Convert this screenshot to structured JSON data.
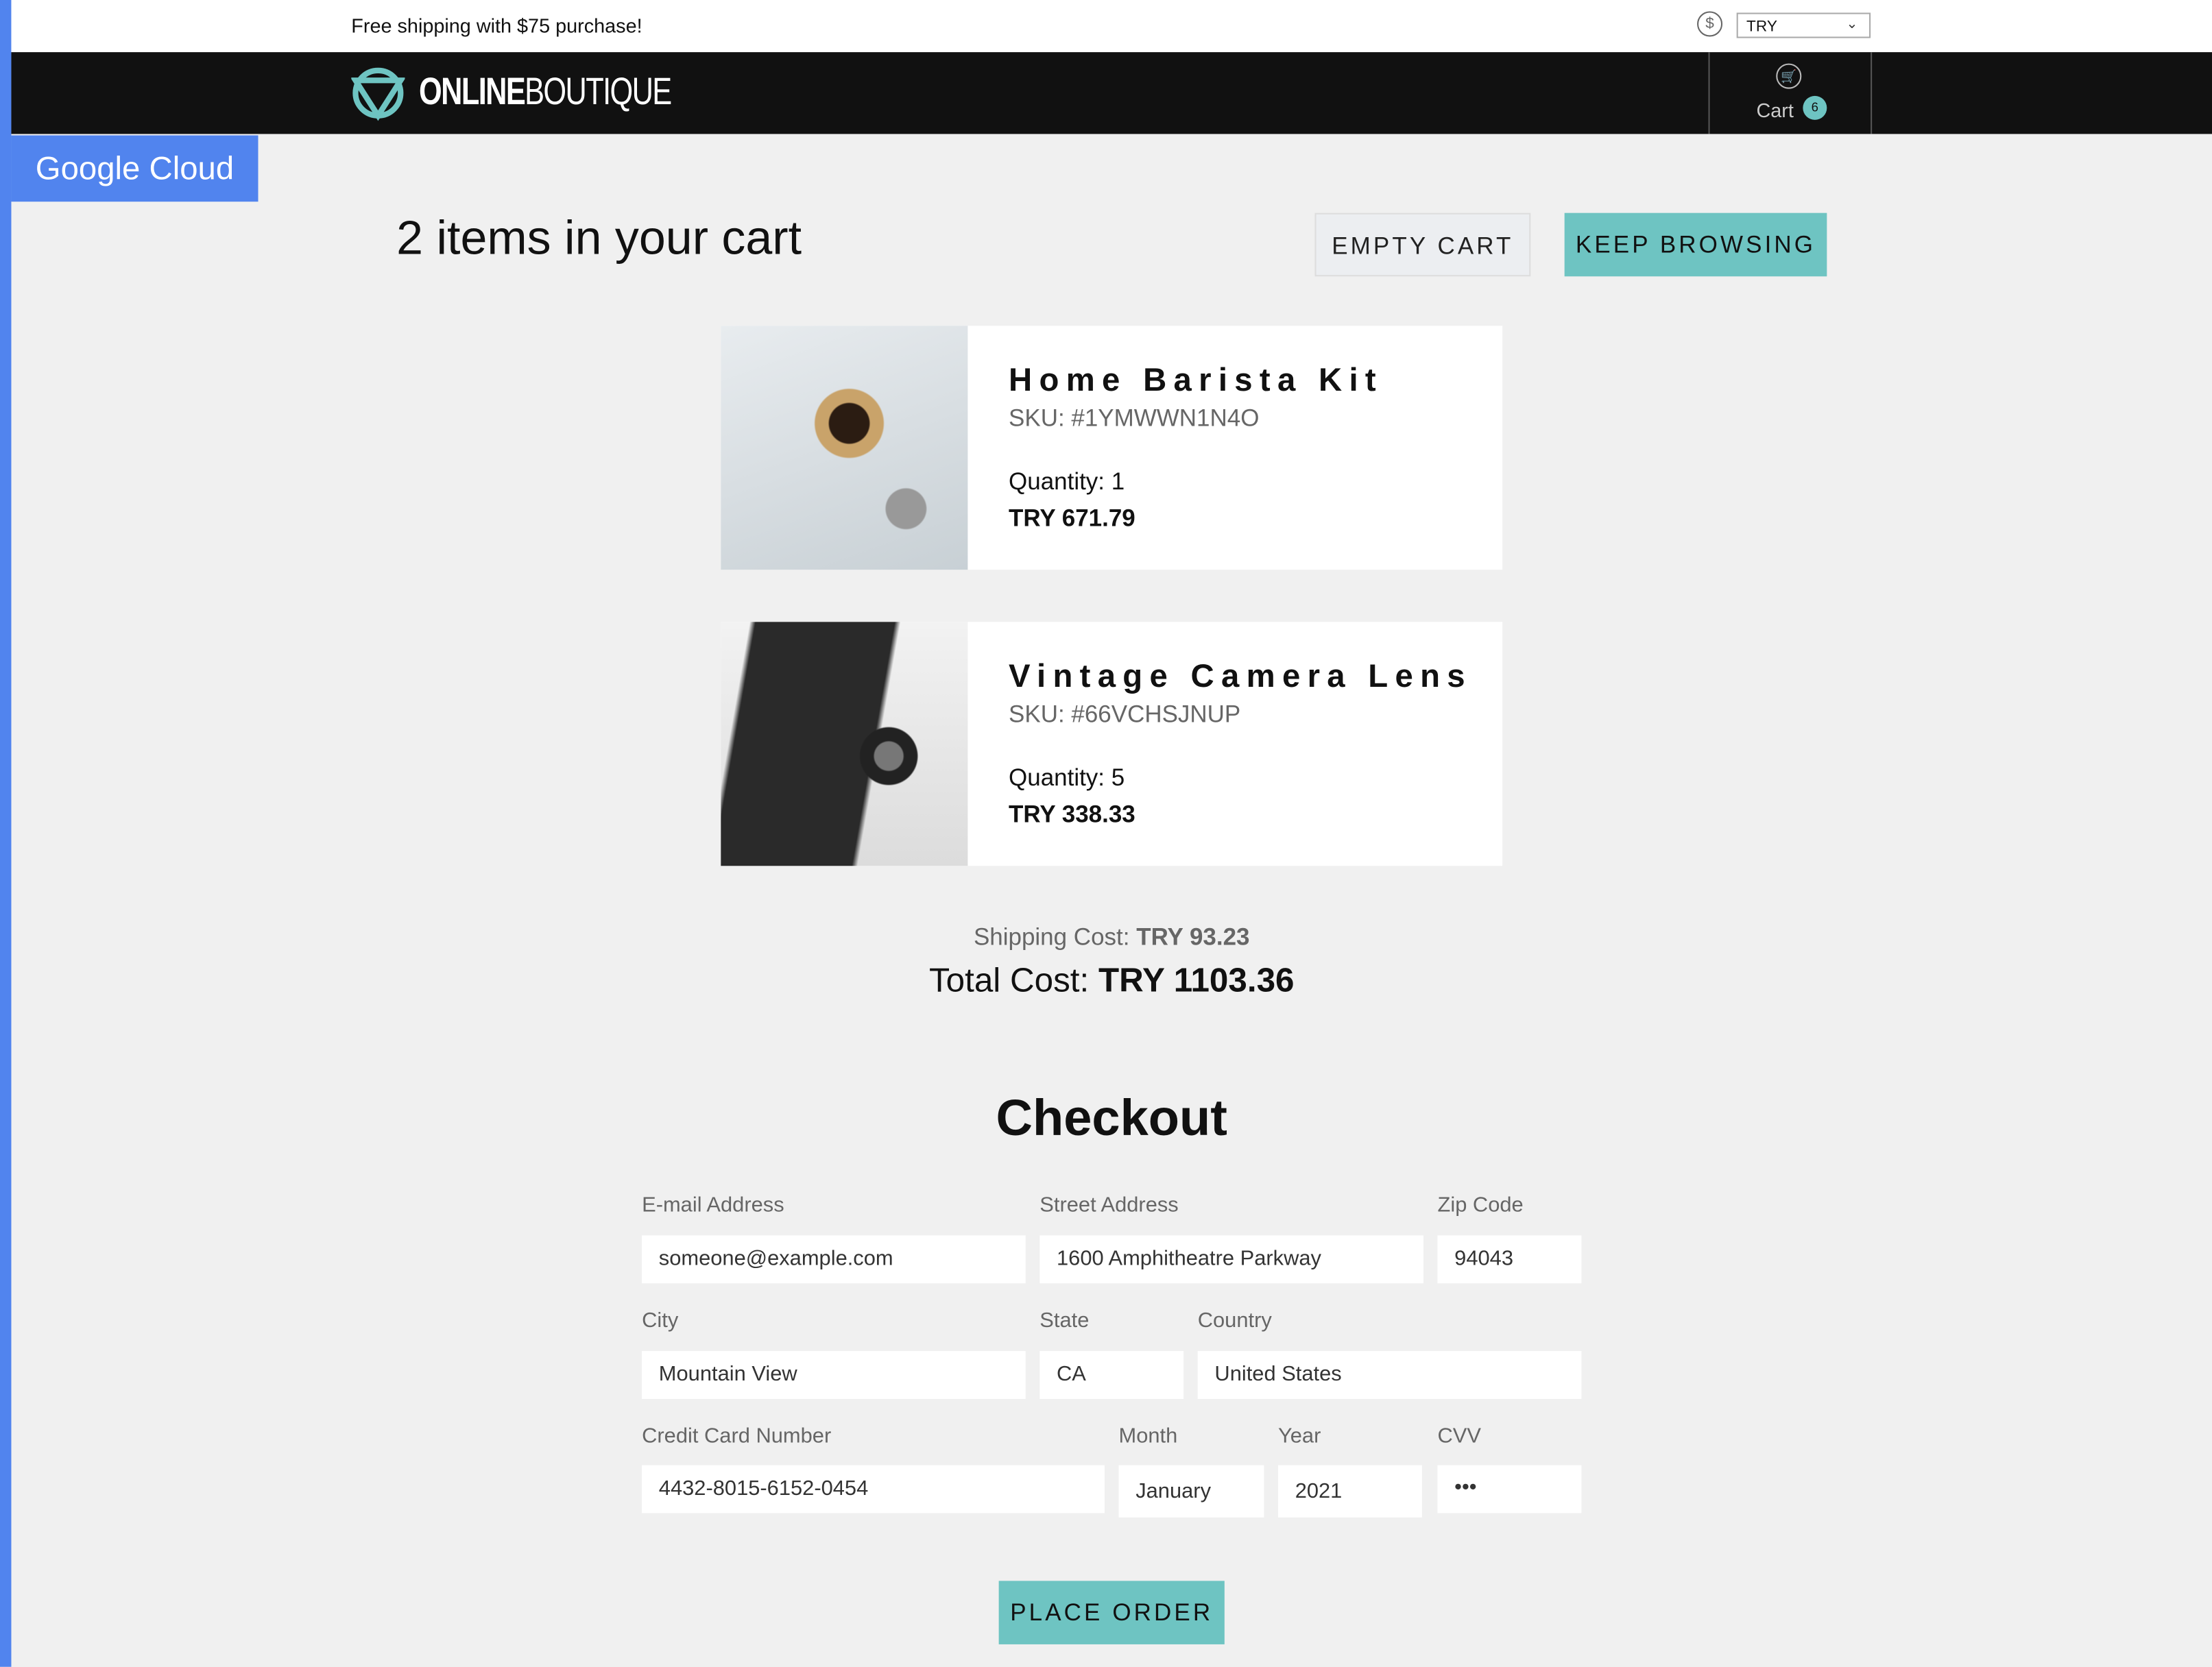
{
  "topbar": {
    "promo": "Free shipping with $75 purchase!",
    "currency_icon": "dollar-circle-icon",
    "currency": "TRY"
  },
  "header": {
    "logo_bold": "ONLINE",
    "logo_light": "BOUTIQUE",
    "cart_label": "Cart",
    "cart_count": "6"
  },
  "badge": "Google Cloud",
  "cart": {
    "title": "2 items in your cart",
    "empty_label": "EMPTY CART",
    "keep_label": "KEEP BROWSING",
    "items": [
      {
        "name": "Home Barista Kit",
        "sku": "SKU: #1YMWWN1N4O",
        "quantity": "Quantity: 1",
        "price": "TRY 671.79"
      },
      {
        "name": "Vintage Camera Lens",
        "sku": "SKU: #66VCHSJNUP",
        "quantity": "Quantity: 5",
        "price": "TRY 338.33"
      }
    ],
    "shipping_label": "Shipping Cost:",
    "shipping_value": "TRY 93.23",
    "total_label": "Total Cost:",
    "total_value": "TRY 1103.36"
  },
  "checkout": {
    "title": "Checkout",
    "email": {
      "label": "E-mail Address",
      "value": "someone@example.com"
    },
    "street": {
      "label": "Street Address",
      "value": "1600 Amphitheatre Parkway"
    },
    "zip": {
      "label": "Zip Code",
      "value": "94043"
    },
    "city": {
      "label": "City",
      "value": "Mountain View"
    },
    "state": {
      "label": "State",
      "value": "CA"
    },
    "country": {
      "label": "Country",
      "value": "United States"
    },
    "card": {
      "label": "Credit Card Number",
      "value": "4432-8015-6152-0454"
    },
    "month": {
      "label": "Month",
      "value": "January"
    },
    "year": {
      "label": "Year",
      "value": "2021"
    },
    "cvv": {
      "label": "CVV",
      "value": "•••"
    },
    "place_label": "PLACE ORDER"
  },
  "colors": {
    "accent": "#6ec4c2",
    "google_blue": "#5184ee",
    "header_bg": "#111111",
    "page_bg": "#f0f0f0"
  }
}
